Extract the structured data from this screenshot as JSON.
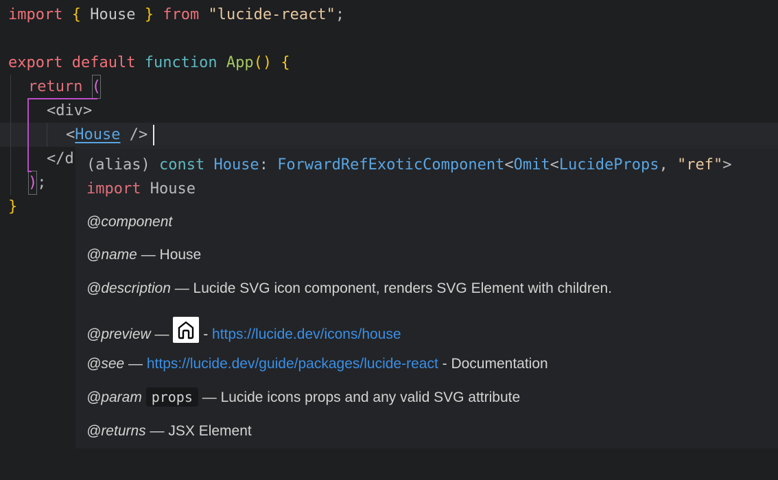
{
  "code": {
    "line1": {
      "kw_import": "import",
      "brace_open": "{",
      "ident": "House",
      "brace_close": "}",
      "kw_from": "from",
      "module": "\"lucide-react\"",
      "semicolon": ";"
    },
    "line3": {
      "kw_export": "export",
      "kw_default": "default",
      "kw_function": "function",
      "fname": "App",
      "parens": "()",
      "brace": "{"
    },
    "line4": {
      "kw_return": "return",
      "paren": "("
    },
    "line5": {
      "tag": "<div>"
    },
    "line6": {
      "lt": "<",
      "component": "House",
      "close": " />"
    },
    "line7": {
      "tag": "</d"
    },
    "line8": {
      "paren": ")",
      "semi": ";"
    },
    "line9": {
      "brace": "}"
    }
  },
  "hover": {
    "sig_alias": "(alias)",
    "sig_const": "const",
    "sig_name": "House",
    "sig_colon": ":",
    "sig_type1": "ForwardRefExoticComponent",
    "sig_lt1": "<",
    "sig_type2": "Omit",
    "sig_lt2": "<",
    "sig_type3": "LucideProps",
    "sig_comma": ", ",
    "sig_str": "\"ref\"",
    "sig_gt": ">",
    "import_kw": "import",
    "import_name": "House",
    "component_tag": "@component",
    "name_tag": "@name",
    "name_value": " — House",
    "description_tag": "@description",
    "description_value": " — Lucide SVG icon component, renders SVG Element with children.",
    "preview_tag": "@preview",
    "preview_dash": " — ",
    "preview_sep": " - ",
    "preview_link": "https://lucide.dev/icons/house",
    "see_tag": "@see",
    "see_dash": " — ",
    "see_link": "https://lucide.dev/guide/packages/lucide-react",
    "see_suffix": " - Documentation",
    "param_tag": "@param",
    "param_code": "props",
    "param_value": " — Lucide icons props and any valid SVG attribute",
    "returns_tag": "@returns",
    "returns_value": " — JSX Element"
  },
  "icons": {
    "preview": "house-icon"
  }
}
